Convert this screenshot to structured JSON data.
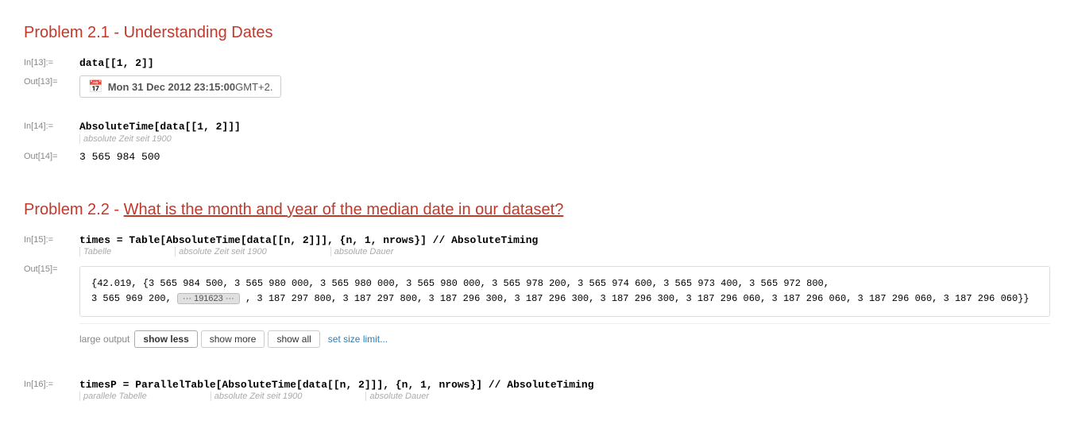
{
  "problem21": {
    "title": "Problem 2.1 - Understanding Dates"
  },
  "in13": {
    "label": "In[13]:=",
    "code": "data[[1, 2]]"
  },
  "out13": {
    "label": "Out[13]=",
    "date_icon": "📅",
    "date_bold": "Mon 31 Dec 2012 23:15:00",
    "date_light": " GMT+2."
  },
  "in14": {
    "label": "In[14]:=",
    "code": "AbsoluteTime[data[[1, 2]]]",
    "hint1": "absolute Zeit seit 1900"
  },
  "out14": {
    "label": "Out[14]=",
    "value": "3 565 984 500"
  },
  "problem22": {
    "title": "Problem 2.2 - What is the month and year of the median date in our dataset?"
  },
  "in15": {
    "label": "In[15]:=",
    "code": "times = Table[AbsoluteTime[data[[n, 2]]], {n, 1, nrows}] // AbsoluteTiming",
    "hint1": "Tabelle",
    "hint2": "absolute Zeit seit 1900",
    "hint3": "absolute Dauer"
  },
  "out15": {
    "label": "Out[15]=",
    "line1": "{42.019, {3 565 984 500, 3 565 980 000, 3 565 980 000, 3 565 980 000, 3 565 978 200, 3 565 974 600, 3 565 973 400, 3 565 972 800,",
    "line2_pre": "    3 565 969 200,",
    "ellipsis_text": "··· 191623 ···",
    "line2_post": ", 3 187 297 800, 3 187 297 800, 3 187 296 300, 3 187 296 300, 3 187 296 300, 3 187 296 060, 3 187 296 060, 3 187 296 060, 3 187 296 060}}",
    "controls": {
      "label": "large output",
      "show_less": "show less",
      "show_more": "show more",
      "show_all": "show all",
      "set_size_limit": "set size limit..."
    }
  },
  "in16": {
    "label": "In[16]:=",
    "code": "timesP = ParallelTable[AbsoluteTime[data[[n, 2]]], {n, 1, nrows}] // AbsoluteTiming",
    "hint1": "parallele Tabelle",
    "hint2": "absolute Zeit seit 1900",
    "hint3": "absolute Dauer"
  }
}
